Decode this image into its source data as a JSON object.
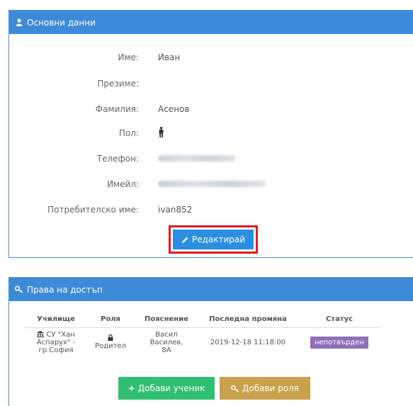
{
  "basic_panel": {
    "title": "Основни данни",
    "fields": [
      {
        "label": "Име:",
        "value": "Иван"
      },
      {
        "label": "Презиме:",
        "value": ""
      },
      {
        "label": "Фамилия:",
        "value": "Асенов"
      },
      {
        "label": "Пол:",
        "value": ""
      },
      {
        "label": "Телефон:",
        "value": ""
      },
      {
        "label": "Имейл:",
        "value": ""
      },
      {
        "label": "Потребителско име:",
        "value": "ivan852"
      }
    ],
    "edit_label": "Редактирай"
  },
  "access_panel": {
    "title": "Права на достъп",
    "columns": [
      "Училище",
      "Роля",
      "Пояснение",
      "Последна промяна",
      "Статус"
    ],
    "row": {
      "school_line1": "СУ \"Хан",
      "school_line2": "Аспарух\" -",
      "school_line3": "гр.София",
      "role": "Родител",
      "note_line1": "Васил Василев,",
      "note_line2": "8А",
      "changed": "2019-12-18 11:18:00",
      "status": "непотвърден"
    },
    "add_student_label": "Добави ученик",
    "add_role_label": "Добави роля"
  },
  "colors": {
    "header": "#3d8bd8",
    "highlight": "#e01b24",
    "green": "#2fbf71",
    "gold": "#c8a14a",
    "badge": "#8e6fb8"
  }
}
